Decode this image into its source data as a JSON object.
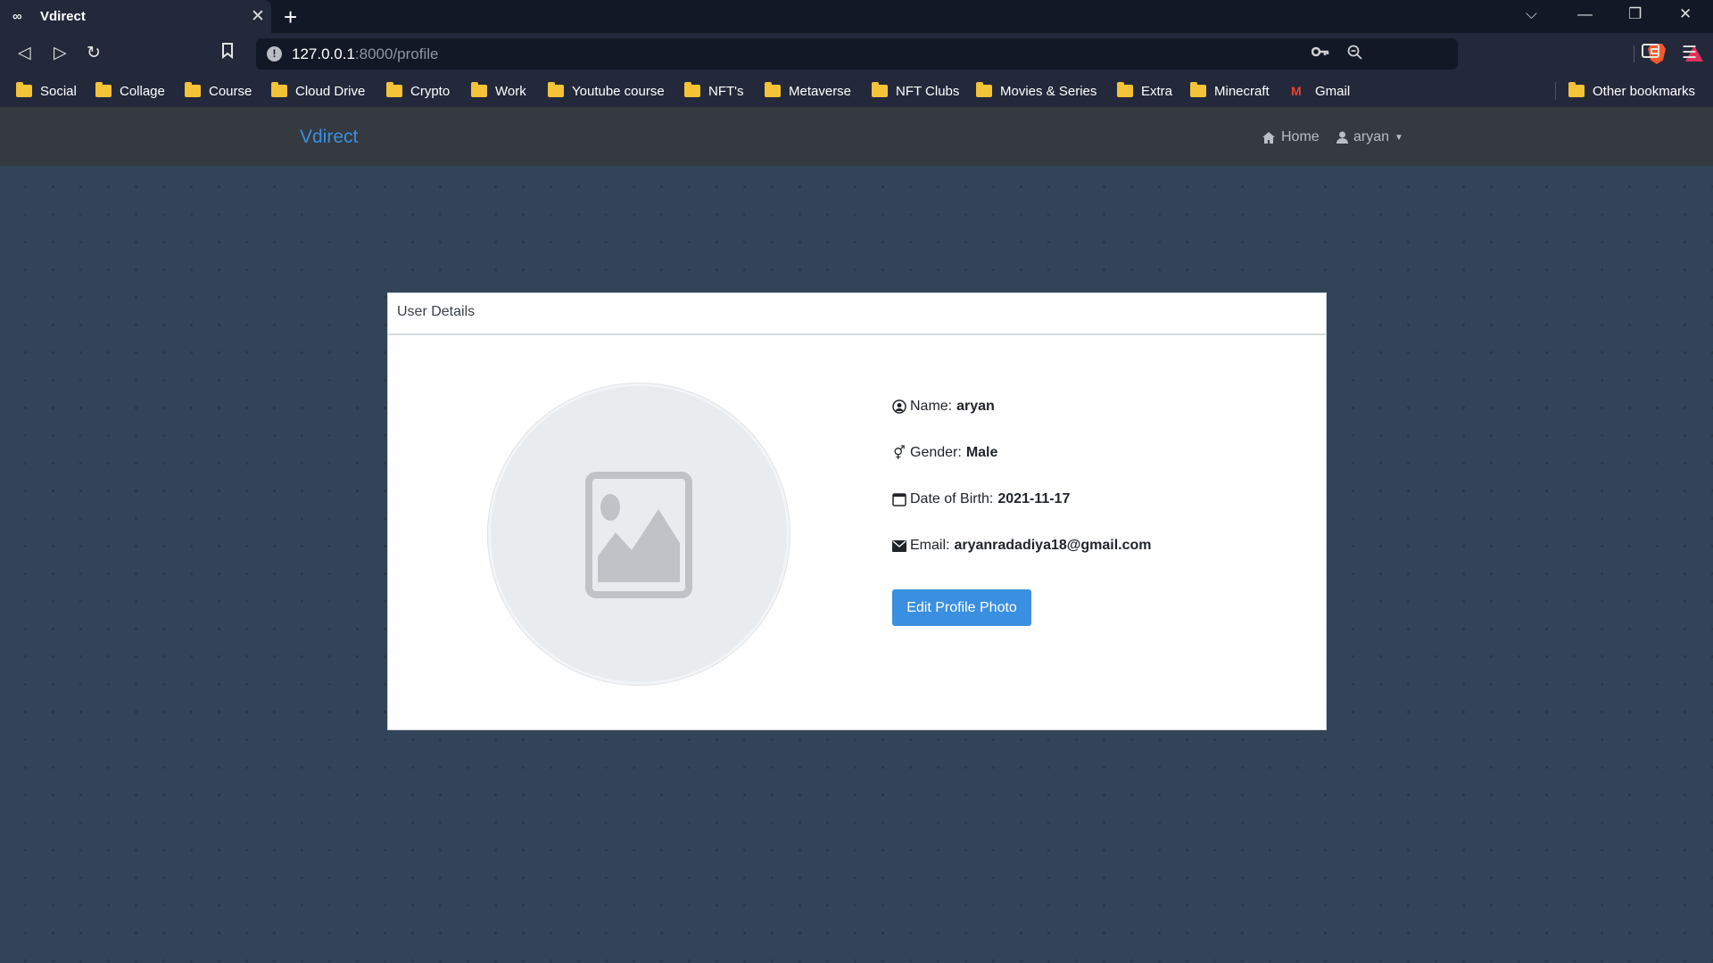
{
  "browser": {
    "tab": {
      "title": "Vdirect",
      "favicon": "infinity-icon"
    },
    "window_controls": [
      "tab-search-icon",
      "minimize-icon",
      "restore-icon",
      "close-icon"
    ],
    "url": {
      "host": "127.0.0.1",
      "path": ":8000/profile"
    },
    "bookmarks": [
      {
        "label": "Social",
        "icon": "folder-icon"
      },
      {
        "label": "Collage",
        "icon": "folder-icon"
      },
      {
        "label": "Course",
        "icon": "folder-icon"
      },
      {
        "label": "Cloud Drive",
        "icon": "folder-icon"
      },
      {
        "label": "Crypto",
        "icon": "folder-icon"
      },
      {
        "label": "Work",
        "icon": "folder-icon"
      },
      {
        "label": "Youtube course",
        "icon": "folder-icon"
      },
      {
        "label": "NFT's",
        "icon": "folder-icon"
      },
      {
        "label": "Metaverse",
        "icon": "folder-icon"
      },
      {
        "label": "NFT Clubs",
        "icon": "folder-icon"
      },
      {
        "label": "Movies & Series",
        "icon": "folder-icon"
      },
      {
        "label": "Extra",
        "icon": "folder-icon"
      },
      {
        "label": "Minecraft",
        "icon": "folder-icon"
      },
      {
        "label": "Gmail",
        "icon": "gmail-icon"
      }
    ],
    "other_bookmarks": "Other bookmarks"
  },
  "navbar": {
    "brand": "Vdirect",
    "home": "Home",
    "user": "aryan"
  },
  "card": {
    "header": "User Details",
    "details": {
      "name_label": "Name:",
      "name_value": "aryan",
      "gender_label": "Gender:",
      "gender_value": "Male",
      "dob_label": "Date of Birth:",
      "dob_value": "2021-11-17",
      "email_label": "Email:",
      "email_value": "aryanradadiya18@gmail.com"
    },
    "edit_button": "Edit Profile Photo"
  },
  "colors": {
    "accent": "#3a8fe0",
    "page_bg": "#324457",
    "navbar_bg": "#343a40"
  }
}
